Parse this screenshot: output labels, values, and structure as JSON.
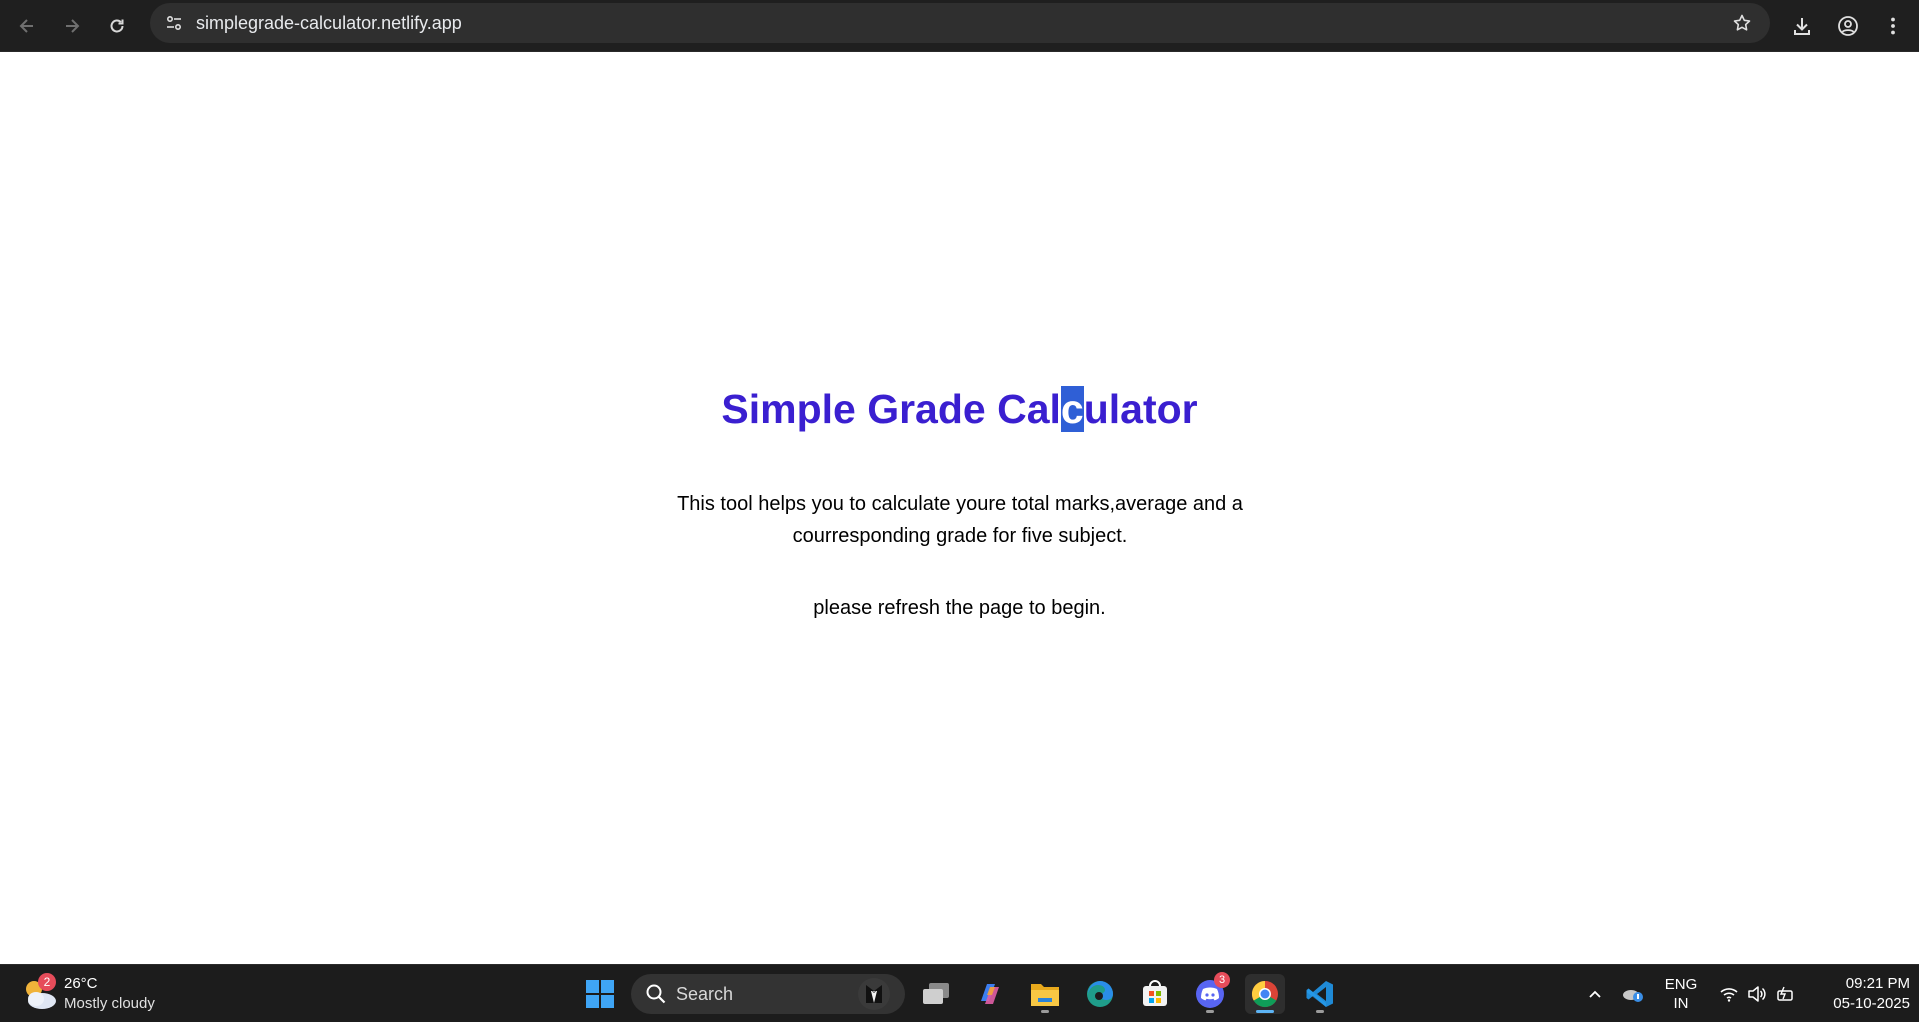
{
  "browser": {
    "url": "simplegrade-calculator.netlify.app",
    "icons": {
      "back": "back-arrow-icon",
      "forward": "forward-arrow-icon",
      "reload": "reload-icon",
      "site_info": "site-info-icon",
      "bookmark": "star-icon",
      "downloads": "download-icon",
      "profile": "profile-icon",
      "menu": "kebab-menu-icon"
    }
  },
  "page": {
    "title_before": "Simple Grade Cal",
    "title_selected": "c",
    "title_after": "ulator",
    "description_line1": "This tool helps you to calculate youre total marks,average and a",
    "description_line2": "courresponding grade for five subject.",
    "instruction": "please refresh the page to begin.",
    "title_color": "#3a1fd0",
    "selection_color": "#2f5fd6"
  },
  "taskbar": {
    "weather": {
      "temperature": "26°C",
      "condition": "Mostly cloudy",
      "badge": "2"
    },
    "search_label": "Search",
    "apps": [
      {
        "name": "start",
        "icon": "windows-logo-icon"
      },
      {
        "name": "task-view",
        "icon": "task-view-icon"
      },
      {
        "name": "copilot",
        "icon": "copilot-icon"
      },
      {
        "name": "file-explorer",
        "icon": "folder-icon"
      },
      {
        "name": "edge",
        "icon": "edge-icon"
      },
      {
        "name": "store",
        "icon": "store-icon"
      },
      {
        "name": "discord",
        "icon": "discord-icon",
        "badge": "3"
      },
      {
        "name": "chrome",
        "icon": "chrome-icon"
      },
      {
        "name": "vscode",
        "icon": "vscode-icon"
      }
    ],
    "language_line1": "ENG",
    "language_line2": "IN",
    "time": "09:21 PM",
    "date": "05-10-2025"
  }
}
